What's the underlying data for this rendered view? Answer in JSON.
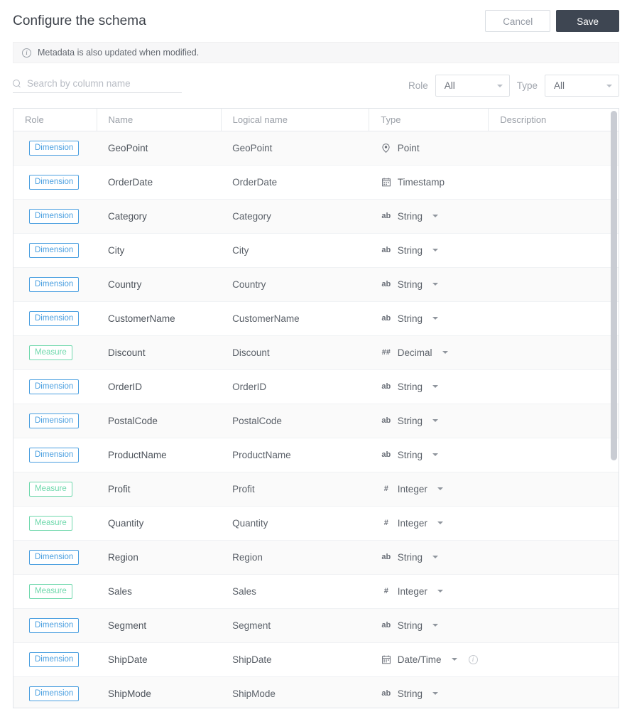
{
  "header": {
    "title": "Configure the schema",
    "cancel_label": "Cancel",
    "save_label": "Save"
  },
  "info_banner": {
    "icon": "info-circle-icon",
    "text": "Metadata is also updated when modified."
  },
  "search": {
    "icon": "search-icon",
    "placeholder": "Search by column name",
    "value": ""
  },
  "filters": {
    "role": {
      "label": "Role",
      "value": "All"
    },
    "type": {
      "label": "Type",
      "value": "All"
    }
  },
  "table": {
    "columns": [
      "Role",
      "Name",
      "Logical name",
      "Type",
      "Description"
    ],
    "rows": [
      {
        "role": "Dimension",
        "name": "GeoPoint",
        "logical": "GeoPoint",
        "type": "Point",
        "type_icon": "map-pin-icon",
        "has_caret": false,
        "has_info": false,
        "description": ""
      },
      {
        "role": "Dimension",
        "name": "OrderDate",
        "logical": "OrderDate",
        "type": "Timestamp",
        "type_icon": "calendar-icon",
        "has_caret": false,
        "has_info": false,
        "description": ""
      },
      {
        "role": "Dimension",
        "name": "Category",
        "logical": "Category",
        "type": "String",
        "type_icon": "ab-icon",
        "has_caret": true,
        "has_info": false,
        "description": ""
      },
      {
        "role": "Dimension",
        "name": "City",
        "logical": "City",
        "type": "String",
        "type_icon": "ab-icon",
        "has_caret": true,
        "has_info": false,
        "description": ""
      },
      {
        "role": "Dimension",
        "name": "Country",
        "logical": "Country",
        "type": "String",
        "type_icon": "ab-icon",
        "has_caret": true,
        "has_info": false,
        "description": ""
      },
      {
        "role": "Dimension",
        "name": "CustomerName",
        "logical": "CustomerName",
        "type": "String",
        "type_icon": "ab-icon",
        "has_caret": true,
        "has_info": false,
        "description": ""
      },
      {
        "role": "Measure",
        "name": "Discount",
        "logical": "Discount",
        "type": "Decimal",
        "type_icon": "hash-hash-icon",
        "has_caret": true,
        "has_info": false,
        "description": ""
      },
      {
        "role": "Dimension",
        "name": "OrderID",
        "logical": "OrderID",
        "type": "String",
        "type_icon": "ab-icon",
        "has_caret": true,
        "has_info": false,
        "description": ""
      },
      {
        "role": "Dimension",
        "name": "PostalCode",
        "logical": "PostalCode",
        "type": "String",
        "type_icon": "ab-icon",
        "has_caret": true,
        "has_info": false,
        "description": ""
      },
      {
        "role": "Dimension",
        "name": "ProductName",
        "logical": "ProductName",
        "type": "String",
        "type_icon": "ab-icon",
        "has_caret": true,
        "has_info": false,
        "description": ""
      },
      {
        "role": "Measure",
        "name": "Profit",
        "logical": "Profit",
        "type": "Integer",
        "type_icon": "hash-icon",
        "has_caret": true,
        "has_info": false,
        "description": ""
      },
      {
        "role": "Measure",
        "name": "Quantity",
        "logical": "Quantity",
        "type": "Integer",
        "type_icon": "hash-icon",
        "has_caret": true,
        "has_info": false,
        "description": ""
      },
      {
        "role": "Dimension",
        "name": "Region",
        "logical": "Region",
        "type": "String",
        "type_icon": "ab-icon",
        "has_caret": true,
        "has_info": false,
        "description": ""
      },
      {
        "role": "Measure",
        "name": "Sales",
        "logical": "Sales",
        "type": "Integer",
        "type_icon": "hash-icon",
        "has_caret": true,
        "has_info": false,
        "description": ""
      },
      {
        "role": "Dimension",
        "name": "Segment",
        "logical": "Segment",
        "type": "String",
        "type_icon": "ab-icon",
        "has_caret": true,
        "has_info": false,
        "description": ""
      },
      {
        "role": "Dimension",
        "name": "ShipDate",
        "logical": "ShipDate",
        "type": "Date/Time",
        "type_icon": "calendar-icon",
        "has_caret": true,
        "has_info": true,
        "description": ""
      },
      {
        "role": "Dimension",
        "name": "ShipMode",
        "logical": "ShipMode",
        "type": "String",
        "type_icon": "ab-icon",
        "has_caret": true,
        "has_info": false,
        "description": ""
      }
    ]
  },
  "colors": {
    "dimension_badge": "#4a9fe0",
    "measure_badge": "#6fd8ac",
    "save_button": "#3e4652",
    "row_alt": "#fafafa"
  }
}
